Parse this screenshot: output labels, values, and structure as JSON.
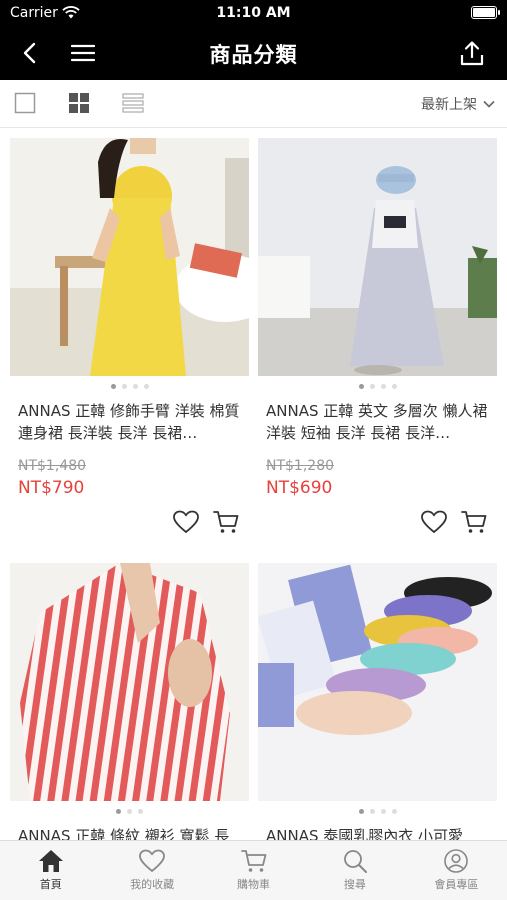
{
  "status_bar": {
    "carrier": "Carrier",
    "time": "11:10 AM"
  },
  "navbar": {
    "title": "商品分類"
  },
  "toolbar": {
    "sort_label": "最新上架"
  },
  "products": [
    {
      "name": "ANNAS 正韓 修飾手臂 洋裝 棉質 連身裙 長洋裝 長洋 長裙…",
      "original_price": "NT$1,480",
      "price": "NT$790",
      "dots": 4,
      "active_dot": 0
    },
    {
      "name": "ANNAS 正韓 英文 多層次 懶人裙 洋裝 短袖 長洋 長裙 長洋…",
      "original_price": "NT$1,280",
      "price": "NT$690",
      "dots": 4,
      "active_dot": 0
    },
    {
      "name": "ANNAS 正韓 條紋 襯衫 寬鬆 長",
      "original_price": "",
      "price": "",
      "dots": 3,
      "active_dot": 0
    },
    {
      "name": "ANNAS 泰國乳膠內衣 小可愛",
      "original_price": "",
      "price": "",
      "dots": 4,
      "active_dot": 0
    }
  ],
  "tabbar": {
    "tabs": [
      {
        "label": "首頁",
        "icon": "home-icon",
        "active": true
      },
      {
        "label": "我的收藏",
        "icon": "heart-icon",
        "active": false
      },
      {
        "label": "購物車",
        "icon": "cart-icon",
        "active": false
      },
      {
        "label": "搜尋",
        "icon": "search-icon",
        "active": false
      },
      {
        "label": "會員專區",
        "icon": "user-icon",
        "active": false
      }
    ]
  },
  "colors": {
    "price": "#e8403a",
    "navbar": "#000000"
  }
}
